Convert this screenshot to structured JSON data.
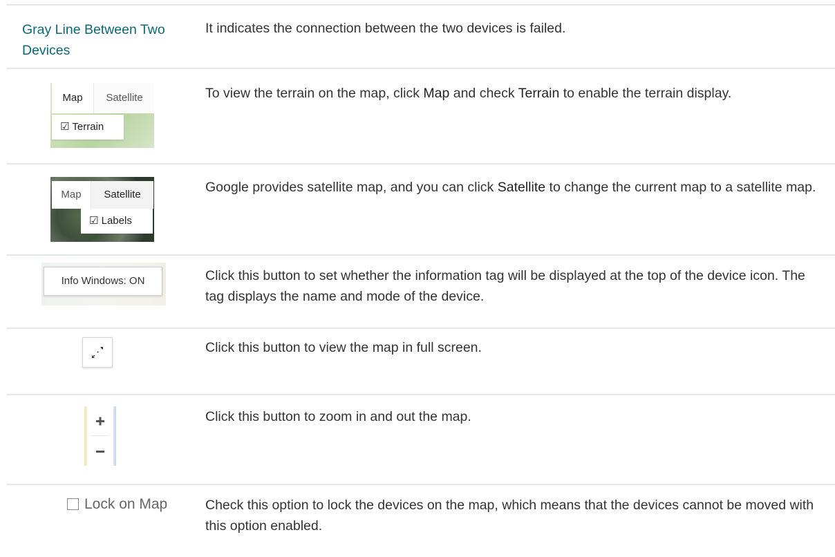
{
  "rows": [
    {
      "term": "Gray Line Between Two Devices",
      "description": "It indicates the connection between the two devices is failed."
    },
    {
      "thumb": {
        "tab_map": "Map",
        "tab_satellite": "Satellite",
        "checkbox_label": "Terrain"
      },
      "desc_parts": [
        "To view the terrain on the map, click ",
        "Map",
        " and check ",
        "Terrain",
        " to enable the terrain display."
      ]
    },
    {
      "thumb": {
        "tab_map": "Map",
        "tab_satellite": "Satellite",
        "checkbox_label": "Labels"
      },
      "desc_parts": [
        "Google provides satellite map, and you can click ",
        "Satellite",
        " to change the current map to a satellite map."
      ]
    },
    {
      "thumb": {
        "button_label": "Info Windows: ON"
      },
      "description": "Click this button to set whether the information tag will be displayed at the top of the device icon. The tag displays the name and mode of the device."
    },
    {
      "thumb": {
        "icon": "fullscreen-icon"
      },
      "description": "Click this button to view the map in full screen."
    },
    {
      "thumb": {
        "plus_icon": "plus-icon",
        "minus_icon": "minus-icon"
      },
      "description": "Click this button to zoom in and out the map."
    },
    {
      "thumb": {
        "checkbox_label": "Lock on Map"
      },
      "description": "Check this option to lock the devices on the map, which means that the devices cannot be moved with this option enabled."
    }
  ]
}
